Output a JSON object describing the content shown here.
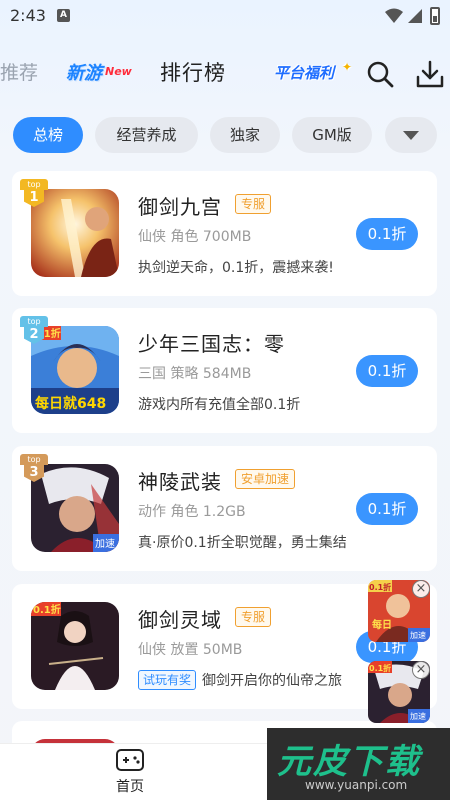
{
  "status_bar": {
    "time": "2:43",
    "notif_letter": "A"
  },
  "top_nav": {
    "recommend": "推荐",
    "new_games_cn": "新游",
    "new_games_en": "New",
    "ranking": "排行榜",
    "welfare": "平台福利"
  },
  "chips": {
    "items": [
      {
        "label": "总榜",
        "active": true
      },
      {
        "label": "经营养成",
        "active": false
      },
      {
        "label": "独家",
        "active": false
      },
      {
        "label": "GM版",
        "active": false
      }
    ]
  },
  "games": [
    {
      "rank_top": "top",
      "rank": "1",
      "title": "御剑九宫",
      "tag": "专服",
      "meta": "仙侠 角色 700MB",
      "desc": "执剑逆天命，0.1折，震撼来袭!",
      "price": "0.1折"
    },
    {
      "rank_top": "top",
      "rank": "2",
      "title": "少年三国志：零",
      "meta": "三国 策略 584MB",
      "desc": "游戏内所有充值全部0.1折",
      "price": "0.1折",
      "thumb_corner": "0.1折",
      "thumb_banner": "每日就648"
    },
    {
      "rank_top": "top",
      "rank": "3",
      "title": "神陵武装",
      "tag": "安卓加速",
      "meta": "动作 角色 1.2GB",
      "desc": "真·原价0.1折全职觉醒，勇士集结",
      "price": "0.1折",
      "thumb_corner": "加速"
    },
    {
      "title": "御剑灵域",
      "tag": "专服",
      "meta": "仙侠 放置 50MB",
      "trial": "试玩有奖",
      "desc": "御剑开启你的仙帝之旅",
      "price": "0.1折",
      "thumb_corner": "0.1折"
    }
  ],
  "float_ads": [
    {
      "corner": "0.1折",
      "banner": "每日",
      "badge": "加速"
    },
    {
      "corner": "0.1折",
      "badge": "加速"
    }
  ],
  "bottom_nav": {
    "home": "首页"
  },
  "watermark": {
    "cn": "元皮下载",
    "url": "www.yuanpi.com"
  },
  "colors": {
    "accent": "#3a95ff",
    "tag_orange": "#f0a030",
    "page_bg": "#f3f5f9"
  }
}
